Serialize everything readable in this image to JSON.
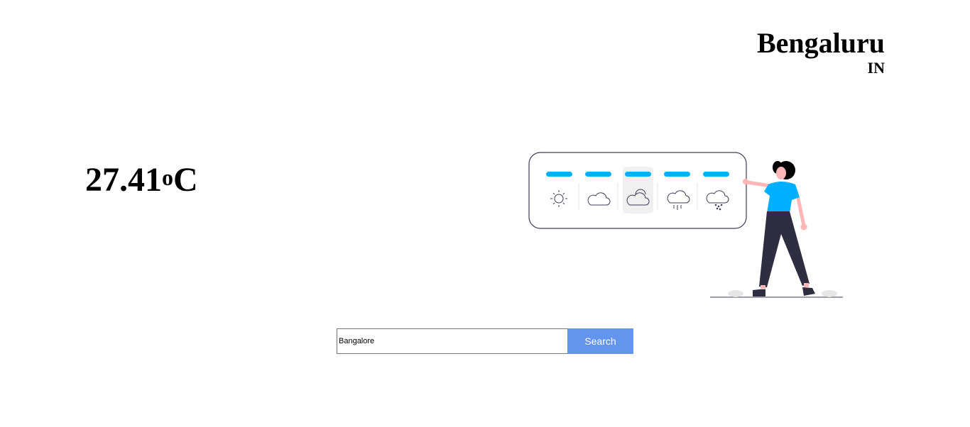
{
  "location": {
    "city": "Bengaluru",
    "country": "IN"
  },
  "weather": {
    "temperature": "27.41",
    "degree_symbol": "o",
    "unit": "C"
  },
  "illustration": {
    "weather_icons": [
      "sun-icon",
      "cloud-icon",
      "sun-behind-cloud-icon",
      "rain-cloud-icon",
      "drizzle-cloud-icon"
    ],
    "selected_index": 2,
    "accent_color": "#00b0ff"
  },
  "search": {
    "value": "Bangalore",
    "button_label": "Search",
    "button_color": "#6495ed"
  }
}
